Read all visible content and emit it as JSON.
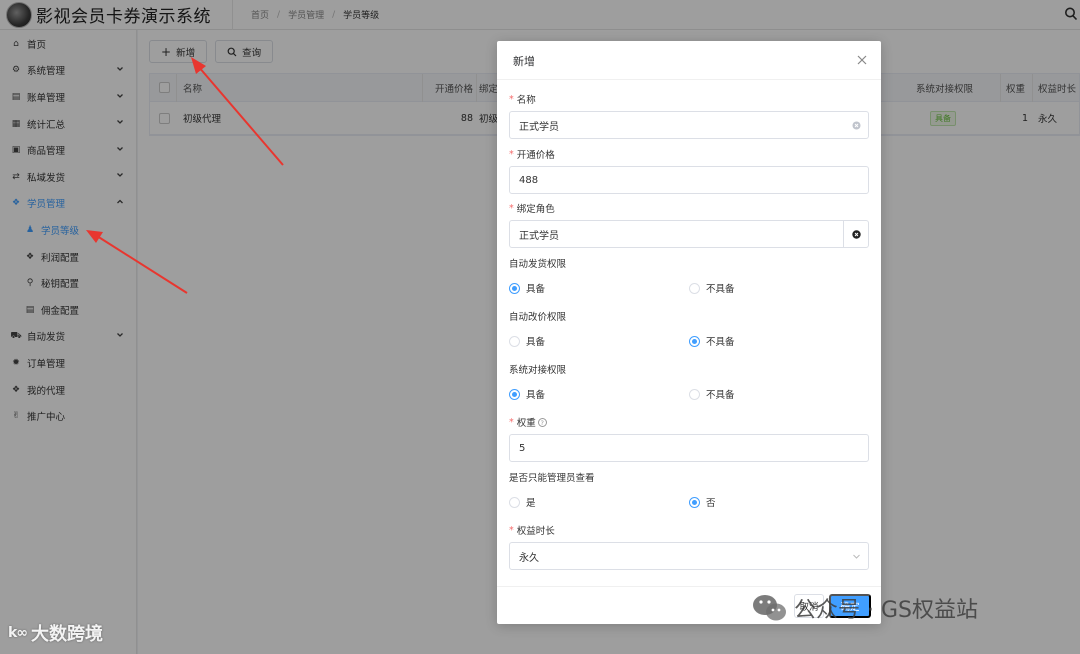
{
  "app": {
    "title": "影视会员卡券演示系统"
  },
  "breadcrumb": [
    "首页",
    "学员管理",
    "学员等级"
  ],
  "breadcrumb_sep": "/",
  "sidebar": {
    "items": [
      {
        "label": "首页",
        "icon": "home-icon"
      },
      {
        "label": "系统管理",
        "icon": "gears-icon",
        "chevron": "down"
      },
      {
        "label": "账单管理",
        "icon": "bill-icon",
        "chevron": "down"
      },
      {
        "label": "统计汇总",
        "icon": "table-icon",
        "chevron": "down"
      },
      {
        "label": "商品管理",
        "icon": "calendar-icon",
        "chevron": "down"
      },
      {
        "label": "私域发货",
        "icon": "shuffle-icon",
        "chevron": "down"
      },
      {
        "label": "学员管理",
        "icon": "tag-icon",
        "chevron": "up"
      },
      {
        "label": "学员等级",
        "icon": "person-icon",
        "sub": true
      },
      {
        "label": "利润配置",
        "icon": "tag-icon",
        "sub": true
      },
      {
        "label": "秘钥配置",
        "icon": "key-icon",
        "sub": true
      },
      {
        "label": "佣金配置",
        "icon": "money-icon",
        "sub": true
      },
      {
        "label": "自动发货",
        "icon": "car-icon",
        "chevron": "down"
      },
      {
        "label": "订单管理",
        "icon": "gear-icon"
      },
      {
        "label": "我的代理",
        "icon": "tag-icon"
      },
      {
        "label": "推广中心",
        "icon": "hand-icon"
      }
    ]
  },
  "toolbar": {
    "add_label": "新增",
    "search_label": "查询"
  },
  "table": {
    "columns": {
      "name": "名称",
      "price": "开通价格",
      "bind": "绑定",
      "sys": "系统对接权限",
      "weight": "权重",
      "duration": "权益时长"
    },
    "rows": [
      {
        "name": "初级代理",
        "price": "88",
        "bind": "初级",
        "sys": "具备",
        "weight": "1",
        "duration": "永久"
      }
    ]
  },
  "dialog": {
    "title": "新增",
    "fields": {
      "name": {
        "label": "名称",
        "value": "正式学员"
      },
      "price": {
        "label": "开通价格",
        "value": "488"
      },
      "role": {
        "label": "绑定角色",
        "value": "正式学员"
      },
      "auto_ship": {
        "label": "自动发货权限",
        "option_yes": "具备",
        "option_no": "不具备",
        "selected": "具备"
      },
      "auto_price": {
        "label": "自动改价权限",
        "option_yes": "具备",
        "option_no": "不具备",
        "selected": "不具备"
      },
      "sys_perm": {
        "label": "系统对接权限",
        "option_yes": "具备",
        "option_no": "不具备",
        "selected": "具备"
      },
      "weight": {
        "label": "权重",
        "value": "5"
      },
      "admin_only": {
        "label": "是否只能管理员查看",
        "option_yes": "是",
        "option_no": "否",
        "selected": "否"
      },
      "duration": {
        "label": "权益时长",
        "value": "永久"
      }
    },
    "cancel_label": "取消",
    "confirm_label": "确定"
  },
  "watermarks": {
    "left": "大数跨境",
    "right": "公众号 · GS权益站"
  },
  "colors": {
    "primary": "#409eff",
    "required": "#f56c6c",
    "arrow": "#e8362f"
  }
}
